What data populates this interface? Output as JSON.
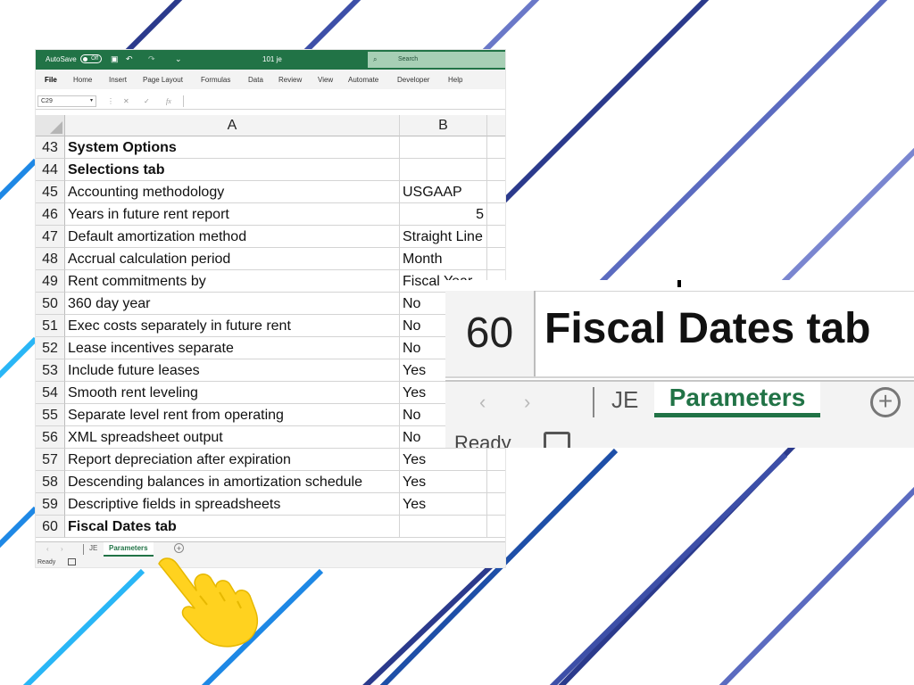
{
  "window": {
    "autosave_label": "AutoSave",
    "autosave_state": "Off",
    "document_name": "101 je",
    "search_placeholder": "Search"
  },
  "ribbon": {
    "tabs": [
      "File",
      "Home",
      "Insert",
      "Page Layout",
      "Formulas",
      "Data",
      "Review",
      "View",
      "Automate",
      "Developer",
      "Help"
    ],
    "active_tab": "File"
  },
  "formula_bar": {
    "name_box": "C29",
    "fx": "fx",
    "cancel_glyph": "✕",
    "enter_glyph": "✓",
    "value": ""
  },
  "grid": {
    "column_headers": [
      "A",
      "B"
    ],
    "rows": [
      {
        "num": "43",
        "a": "System Options",
        "b": "",
        "bold": true
      },
      {
        "num": "44",
        "a": "Selections tab",
        "b": "",
        "bold": true
      },
      {
        "num": "45",
        "a": "Accounting methodology",
        "b": "USGAAP"
      },
      {
        "num": "46",
        "a": "Years in future rent report",
        "b": "5",
        "numeric": true
      },
      {
        "num": "47",
        "a": "Default amortization method",
        "b": "Straight Line"
      },
      {
        "num": "48",
        "a": "Accrual calculation period",
        "b": "Month"
      },
      {
        "num": "49",
        "a": "Rent commitments by",
        "b": "Fiscal Year"
      },
      {
        "num": "50",
        "a": "360 day year",
        "b": "No"
      },
      {
        "num": "51",
        "a": "Exec costs separately in future rent",
        "b": "No"
      },
      {
        "num": "52",
        "a": "Lease incentives separate",
        "b": "No"
      },
      {
        "num": "53",
        "a": "Include future leases",
        "b": "Yes"
      },
      {
        "num": "54",
        "a": "Smooth rent leveling",
        "b": "Yes"
      },
      {
        "num": "55",
        "a": "Separate level rent from operating",
        "b": "No"
      },
      {
        "num": "56",
        "a": "XML spreadsheet output",
        "b": "No"
      },
      {
        "num": "57",
        "a": "Report depreciation after expiration",
        "b": "Yes"
      },
      {
        "num": "58",
        "a": "Descending balances in amortization schedule",
        "b": "Yes"
      },
      {
        "num": "59",
        "a": "Descriptive fields in spreadsheets",
        "b": "Yes"
      },
      {
        "num": "60",
        "a": "Fiscal Dates tab",
        "b": "",
        "bold": true
      }
    ]
  },
  "sheet_tabs": {
    "tabs": [
      "JE",
      "Parameters"
    ],
    "active": "Parameters",
    "add_glyph": "+",
    "prev_glyph": "‹",
    "next_glyph": "›"
  },
  "status_bar": {
    "status": "Ready"
  },
  "zoom_callout": {
    "row_number": "60",
    "cell_text": "Fiscal Dates tab",
    "tab_je": "JE",
    "tab_parameters": "Parameters",
    "add_glyph": "+",
    "status": "Ready"
  },
  "colors": {
    "excel_green": "#217346",
    "hand_yellow": "#FFD21F",
    "stripe_blues": [
      "#2B3A8C",
      "#5B6BC0",
      "#1E88E5",
      "#29B6F6"
    ]
  }
}
